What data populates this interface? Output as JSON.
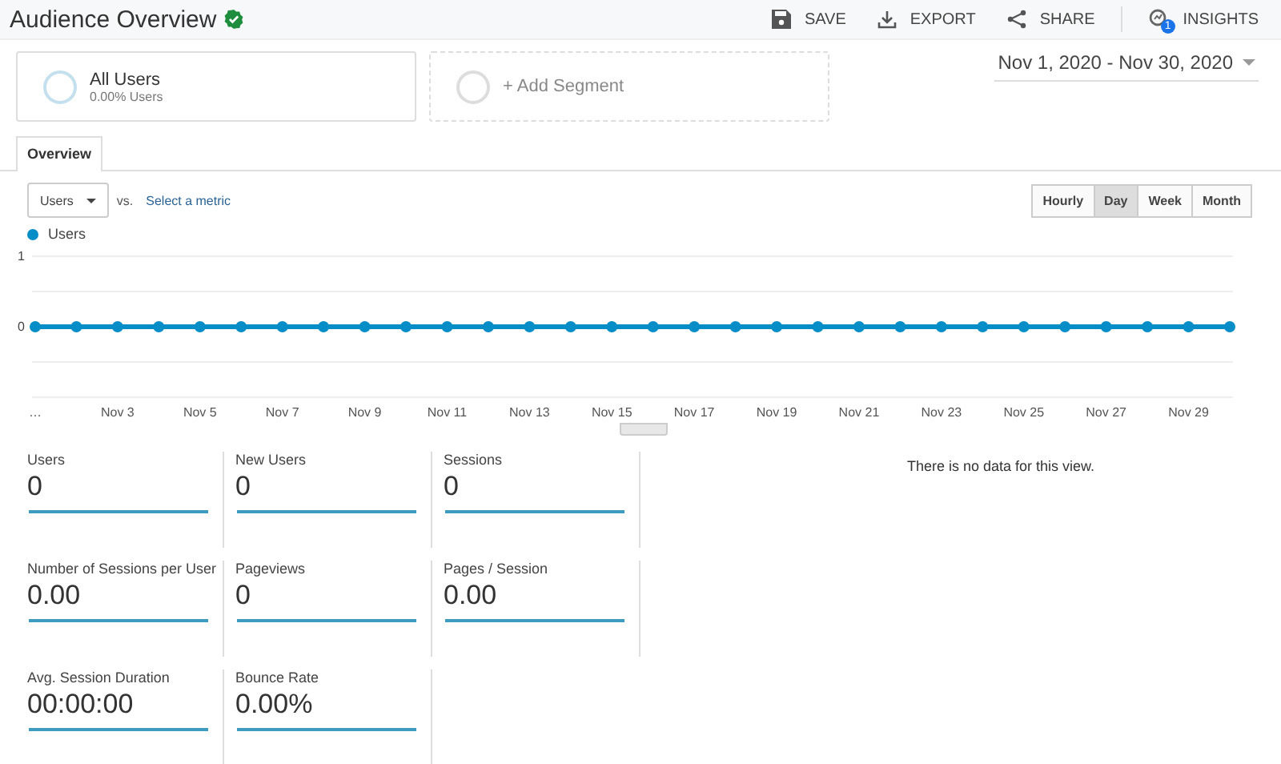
{
  "header": {
    "title": "Audience Overview",
    "verified": true,
    "actions": [
      {
        "label": "SAVE",
        "kind": "save"
      },
      {
        "label": "EXPORT",
        "kind": "export"
      },
      {
        "label": "SHARE",
        "kind": "share"
      },
      {
        "label": "INSIGHTS",
        "kind": "insights",
        "badge": "1"
      }
    ]
  },
  "segments": [
    {
      "kind": "active",
      "name": "All Users",
      "subtitle": "0.00% Users"
    },
    {
      "kind": "add",
      "name": "+ Add Segment"
    }
  ],
  "date_range": "Nov 1, 2020 - Nov 30, 2020",
  "tabs": [
    {
      "label": "Overview",
      "selected": true
    }
  ],
  "metric_selector": {
    "value": "Users",
    "vs": "vs.",
    "link": "Select a metric"
  },
  "granularity": [
    {
      "label": "Hourly",
      "selected": false
    },
    {
      "label": "Day",
      "selected": true
    },
    {
      "label": "Week",
      "selected": false
    },
    {
      "label": "Month",
      "selected": false
    }
  ],
  "chart": {
    "chart_data": {
      "type": "line",
      "categories": [
        "…",
        null,
        "Nov 3",
        null,
        "Nov 5",
        null,
        "Nov 7",
        null,
        "Nov 9",
        null,
        "Nov 11",
        null,
        "Nov 13",
        null,
        "Nov 15",
        null,
        "Nov 17",
        null,
        "Nov 19",
        null,
        "Nov 21",
        null,
        "Nov 23",
        null,
        "Nov 25",
        null,
        "Nov 27",
        null,
        "Nov 29",
        null
      ],
      "series": [
        {
          "name": "Users",
          "color": "#058dc7",
          "marker": "circle",
          "values": [
            0,
            0,
            0,
            0,
            0,
            0,
            0,
            0,
            0,
            0,
            0,
            0,
            0,
            0,
            0,
            0,
            0,
            0,
            0,
            0,
            0,
            0,
            0,
            0,
            0,
            0,
            0,
            0,
            0,
            0
          ]
        }
      ],
      "ylim": [
        -1,
        1
      ],
      "yticks": [
        0,
        1
      ],
      "ref_lines": [
        {
          "axis": "y",
          "value": 0.5
        },
        {
          "axis": "y",
          "value": -0.5
        }
      ]
    }
  },
  "metrics": [
    {
      "label": "Users",
      "value": "0"
    },
    {
      "label": "New Users",
      "value": "0"
    },
    {
      "label": "Sessions",
      "value": "0"
    },
    {
      "label": "Number of Sessions per User",
      "value": "0.00"
    },
    {
      "label": "Pageviews",
      "value": "0"
    },
    {
      "label": "Pages / Session",
      "value": "0.00"
    },
    {
      "label": "Avg. Session Duration",
      "value": "00:00:00"
    },
    {
      "label": "Bounce Rate",
      "value": "0.00%"
    }
  ],
  "no_data_message": "There is no data for this view."
}
